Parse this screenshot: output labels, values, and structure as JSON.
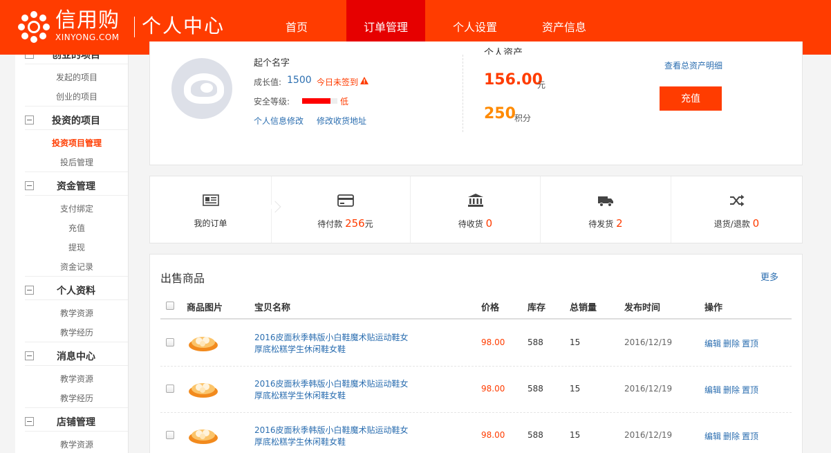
{
  "header": {
    "brand_name": "信用购",
    "brand_domain": "XINYONG.COM",
    "center_title": "个人中心",
    "nav": [
      "首页",
      "订单管理",
      "个人设置",
      "资产信息"
    ],
    "active_nav": "订单管理",
    "brand_color": "#ff3c00"
  },
  "sidebar": {
    "groups": [
      {
        "title": "创业的项目",
        "items": [
          "发起的项目",
          "创业的项目"
        ]
      },
      {
        "title": "投资的项目",
        "items": [
          "投资项目管理",
          "投后管理"
        ],
        "active_item": "投资项目管理"
      },
      {
        "title": "资金管理",
        "items": [
          "支付绑定",
          "充值",
          "提现",
          "资金记录"
        ]
      },
      {
        "title": "个人资料",
        "items": [
          "教学资源",
          "教学经历"
        ]
      },
      {
        "title": "消息中心",
        "items": [
          "教学资源",
          "教学经历"
        ]
      },
      {
        "title": "店铺管理",
        "items": [
          "教学资源"
        ]
      }
    ]
  },
  "profile": {
    "name": "起个名字",
    "growth_label": "成长值:",
    "growth_value": "1500",
    "signin_status": "今日未签到",
    "safety_label": "安全等级:",
    "safety_level_text": "低",
    "safety_level_fraction": 0.8,
    "edit_profile_link": "个人信息修改",
    "edit_address_link": "修改收货地址"
  },
  "assets": {
    "title": "个人资产",
    "balance": "156.00",
    "balance_unit": "元",
    "points": "250",
    "points_unit": "积分",
    "view_detail_link": "查看总资产明细",
    "recharge_button": "充值"
  },
  "order_stats": [
    {
      "icon": "newspaper-icon",
      "label": "我的订单",
      "value": ""
    },
    {
      "icon": "credit-card-icon",
      "label": "待付款",
      "value": "256",
      "unit": "元"
    },
    {
      "icon": "bank-icon",
      "label": "待收货",
      "value": "0",
      "unit": ""
    },
    {
      "icon": "truck-icon",
      "label": "待发货",
      "value": "2",
      "unit": ""
    },
    {
      "icon": "shuffle-icon",
      "label": "退货/退款",
      "value": "0",
      "unit": ""
    }
  ],
  "products": {
    "section_title": "出售商品",
    "more_link": "更多",
    "columns": [
      "商品图片",
      "宝贝名称",
      "价格",
      "库存",
      "总销量",
      "发布时间",
      "操作"
    ],
    "rows": [
      {
        "name_line1": "2016皮面秋季韩版小白鞋魔术贴运动鞋女",
        "name_line2": "厚底松糕学生休闲鞋女鞋",
        "price": "98.00",
        "stock": "588",
        "sales": "15",
        "date": "2016/12/19",
        "ops": [
          "编辑",
          "删除",
          "置顶"
        ]
      },
      {
        "name_line1": "2016皮面秋季韩版小白鞋魔术贴运动鞋女",
        "name_line2": "厚底松糕学生休闲鞋女鞋",
        "price": "98.00",
        "stock": "588",
        "sales": "15",
        "date": "2016/12/19",
        "ops": [
          "编辑",
          "删除",
          "置顶"
        ]
      },
      {
        "name_line1": "2016皮面秋季韩版小白鞋魔术贴运动鞋女",
        "name_line2": "厚底松糕学生休闲鞋女鞋",
        "price": "98.00",
        "stock": "588",
        "sales": "15",
        "date": "2016/12/19",
        "ops": [
          "编辑",
          "删除",
          "置顶"
        ]
      }
    ]
  }
}
